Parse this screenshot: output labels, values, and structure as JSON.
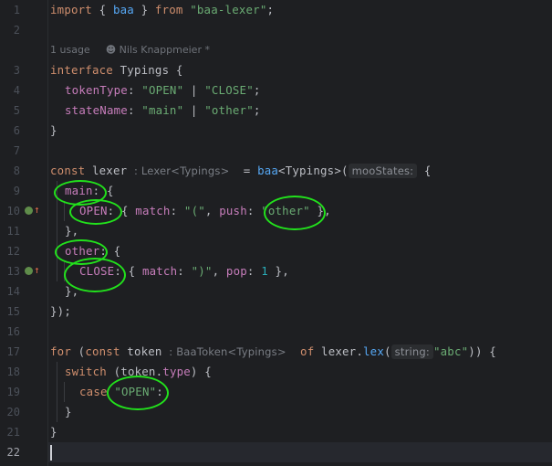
{
  "editor": {
    "line_numbers": [
      "1",
      "2",
      "3",
      "4",
      "5",
      "6",
      "7",
      "8",
      "9",
      "10",
      "11",
      "12",
      "13",
      "14",
      "15",
      "16",
      "17",
      "18",
      "19",
      "20",
      "21",
      "22"
    ],
    "current_line": "22",
    "codevision": {
      "usages": "1 usage",
      "author": "Nils Knappmeier *"
    },
    "lines": {
      "l1": {
        "kw1": "import",
        "p1": " { ",
        "id": "baa",
        "p2": " } ",
        "kw2": "from",
        "sp": " ",
        "str": "\"baa-lexer\"",
        "end": ";"
      },
      "l3": {
        "kw": "interface",
        "sp": " ",
        "name": "Typings",
        "end": " {"
      },
      "l4": {
        "prop": "tokenType",
        "colon": ": ",
        "s1": "\"OPEN\"",
        "bar": " | ",
        "s2": "\"CLOSE\"",
        "end": ";"
      },
      "l5": {
        "prop": "stateName",
        "colon": ": ",
        "s1": "\"main\"",
        "bar": " | ",
        "s2": "\"other\"",
        "end": ";"
      },
      "l6": {
        "text": "}"
      },
      "l8": {
        "kw": "const",
        "sp": " ",
        "var": "lexer",
        "hint": ": Lexer<Typings>",
        "eq": "  = ",
        "fn": "baa",
        "gen": "<Typings>(",
        "param": "mooStates:",
        "end": " {"
      },
      "l9": {
        "prop": "main",
        "end": ": {"
      },
      "l10": {
        "prop": "OPEN",
        "p1": ": { ",
        "m": "match",
        "p2": ": ",
        "s1": "\"(\"",
        "p3": ", ",
        "push": "push",
        "p4": ": ",
        "s2": "\"other\"",
        "end": " },"
      },
      "l11": {
        "text": "},"
      },
      "l12": {
        "prop": "other",
        "end": ": {"
      },
      "l13": {
        "prop": "CLOSE",
        "p1": ": { ",
        "m": "match",
        "p2": ": ",
        "s1": "\")\"",
        "p3": ", ",
        "pop": "pop",
        "p4": ": ",
        "num": "1",
        "end": " },"
      },
      "l14": {
        "text": "},"
      },
      "l15": {
        "text": "});"
      },
      "l17": {
        "kw1": "for",
        "p1": " (",
        "kw2": "const",
        "sp": " ",
        "var": "token",
        "hint": ": BaaToken<Typings>",
        "sp2": "  ",
        "kw3": "of",
        "sp3": " ",
        "obj": "lexer",
        "dot": ".",
        "fn": "lex",
        "par": "(",
        "param": "string:",
        "s": "\"abc\"",
        "end": ")) {"
      },
      "l18": {
        "kw": "switch",
        "p1": " (",
        "obj": "token",
        "dot": ".",
        "prop": "type",
        "end": ") {"
      },
      "l19": {
        "kw": "case",
        "sp": " ",
        "s": "\"OPEN\"",
        "end": ":"
      },
      "l20": {
        "text": "}"
      },
      "l21": {
        "text": "}"
      }
    },
    "gutter_icons": [
      {
        "line": "10",
        "icon": "implemented-interface-icon"
      },
      {
        "line": "13",
        "icon": "implemented-interface-icon"
      }
    ],
    "annotation_color": "#22e11c"
  }
}
